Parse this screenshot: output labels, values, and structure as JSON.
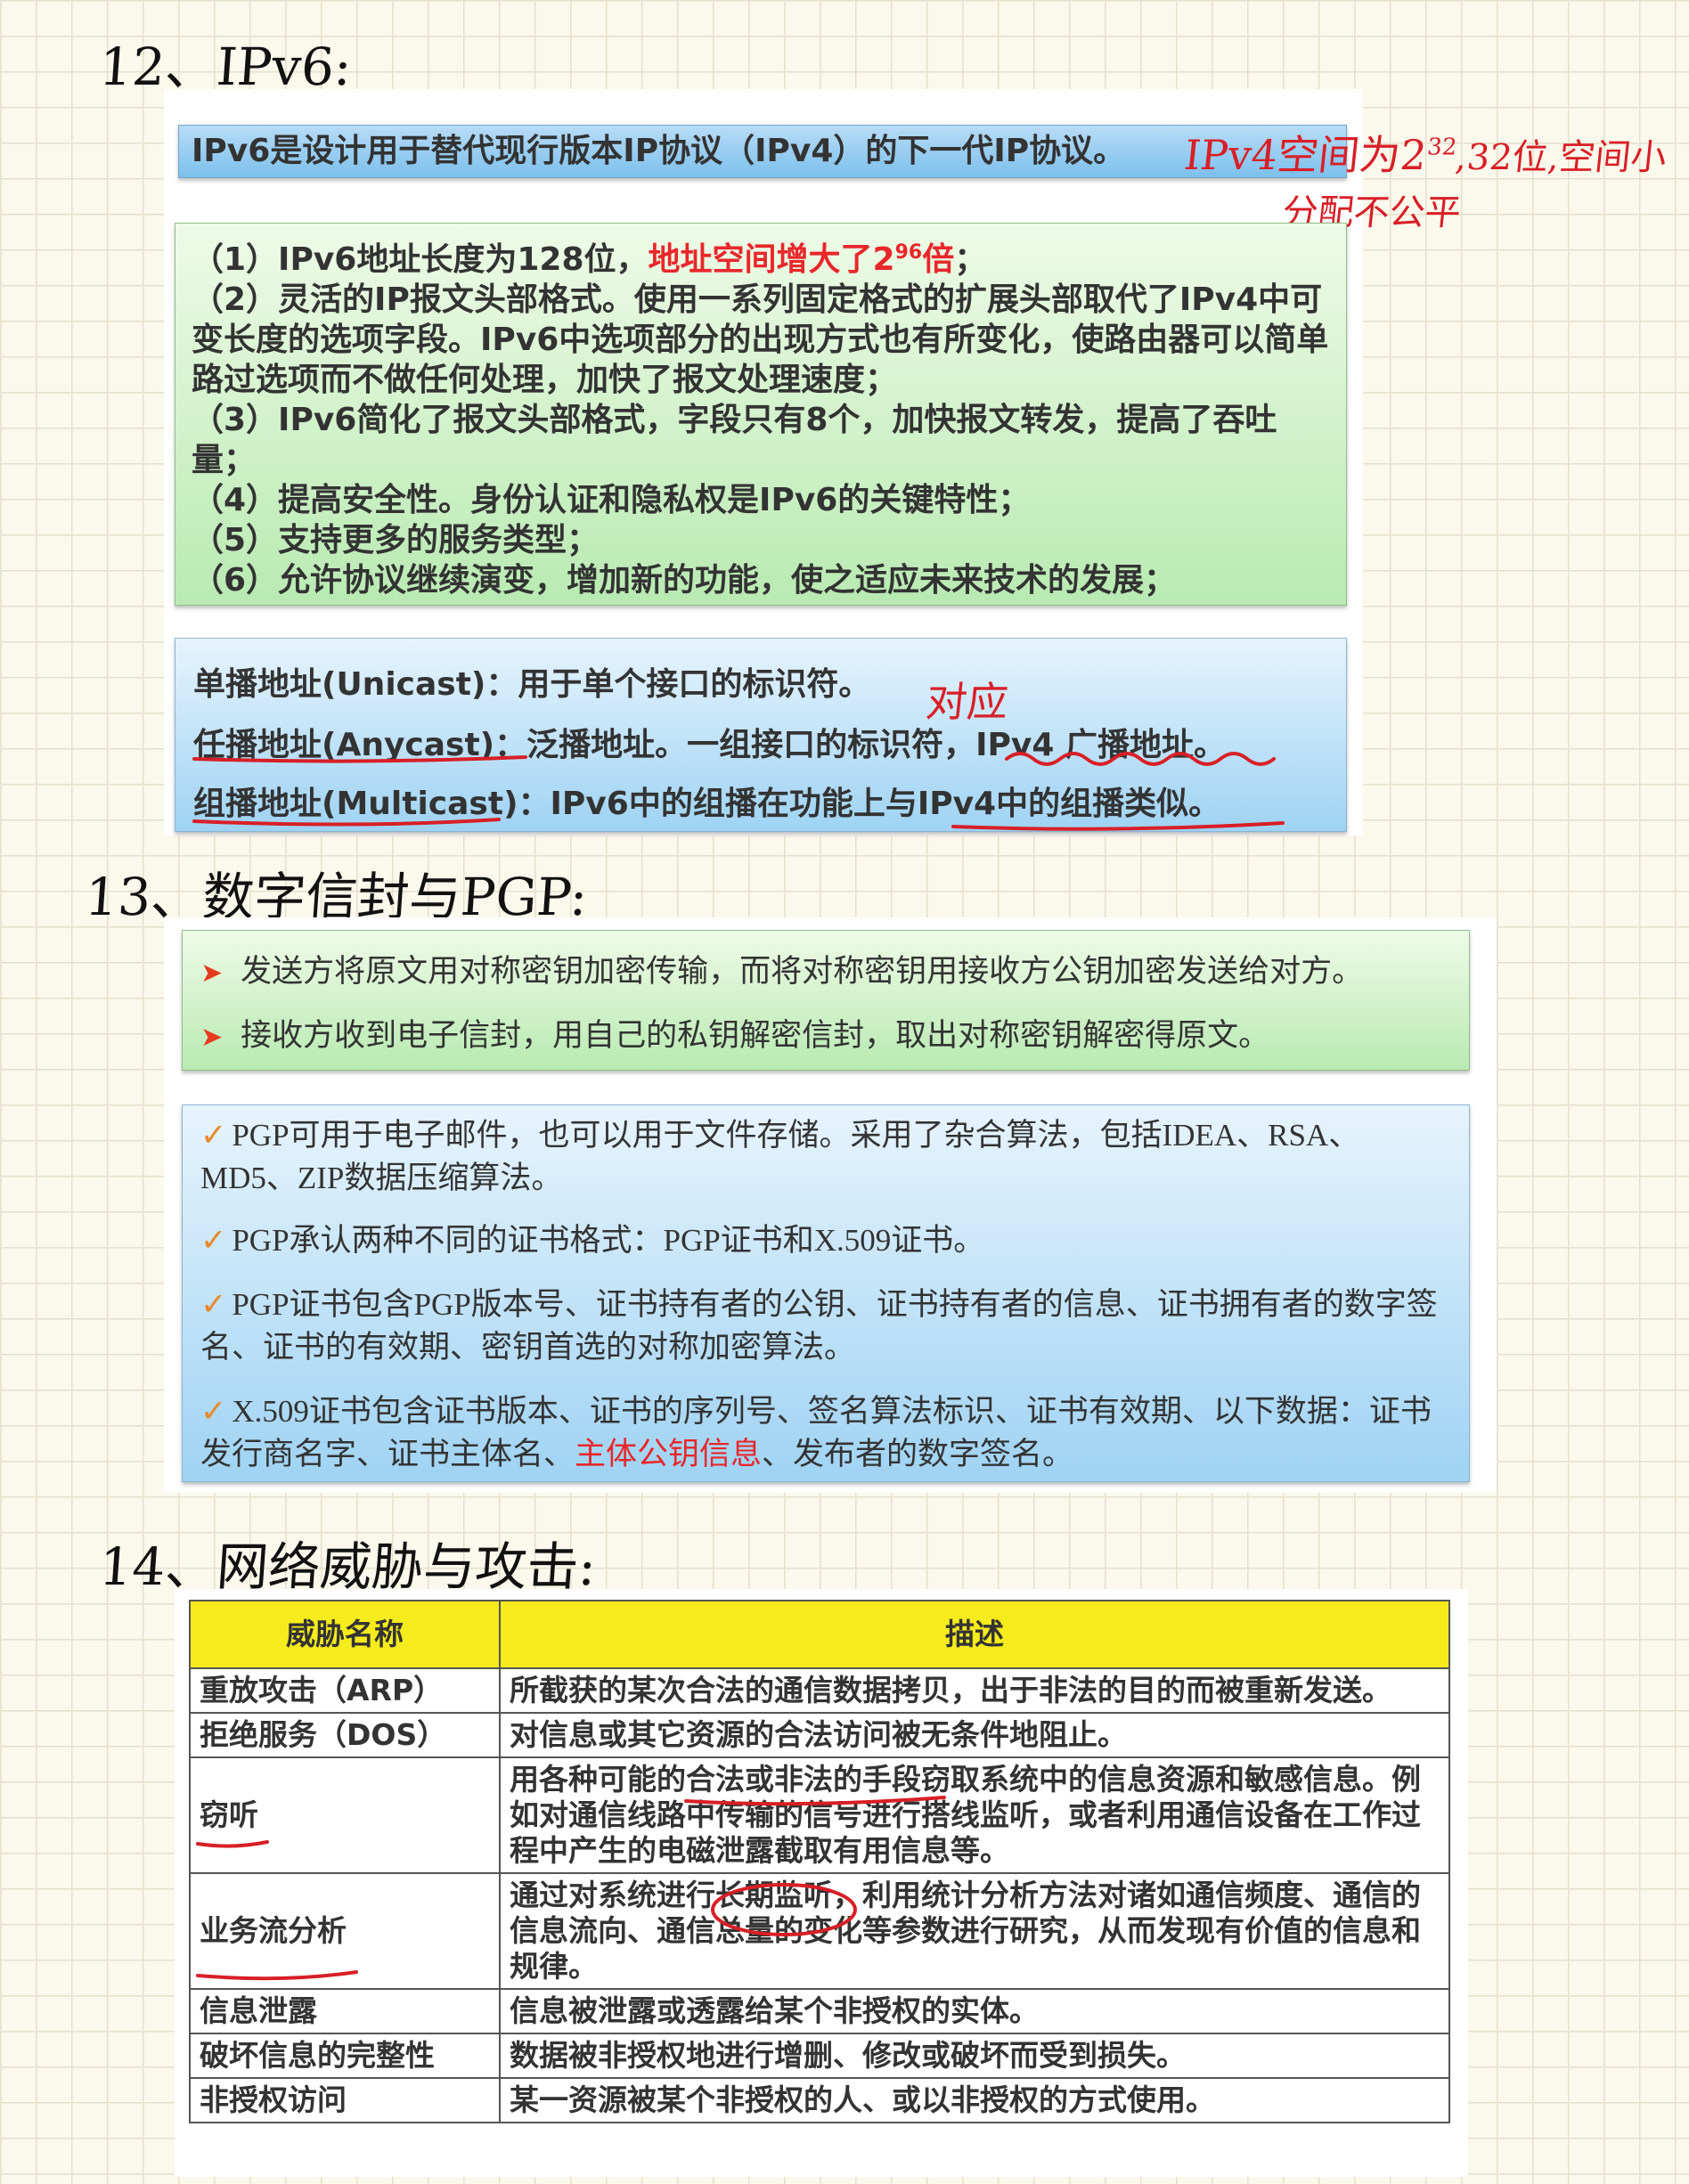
{
  "headings": {
    "h12": "12、IPv6:",
    "h13": "13、数字信封与PGP:",
    "h14": "14、网络威胁与攻击:"
  },
  "ipv6": {
    "intro": "IPv6是设计用于替代现行版本IP协议（IPv4）的下一代IP协议。",
    "note_line1": "IPv4空间为2",
    "note_sup": "32",
    "note_line1_rest": ",32位,空间小",
    "note_line2": "分配不公平",
    "features": [
      {
        "pre": "（1）IPv6地址长度为128位，",
        "red": "地址空间增大了2",
        "sup": "96",
        "red2": "倍",
        "post": "；"
      },
      {
        "text": "（2）灵活的IP报文头部格式。使用一系列固定格式的扩展头部取代了IPv4中可变长度的选项字段。IPv6中选项部分的出现方式也有所变化，使路由器可以简单路过选项而不做任何处理，加快了报文处理速度；"
      },
      {
        "text": "（3）IPv6简化了报文头部格式，字段只有8个，加快报文转发，提高了吞吐量；"
      },
      {
        "text": "（4）提高安全性。身份认证和隐私权是IPv6的关键特性；"
      },
      {
        "text": "（5）支持更多的服务类型；"
      },
      {
        "text": "（6）允许协议继续演变，增加新的功能，使之适应未来技术的发展；"
      }
    ],
    "addresses": [
      "单播地址(Unicast)：用于单个接口的标识符。",
      "任播地址(Anycast)：泛播地址。一组接口的标识符，IPv4 广播地址。",
      "组播地址(Multicast)：IPv6中的组播在功能上与IPv4中的组播类似。"
    ],
    "annotation_duiying": "对应"
  },
  "pgp": {
    "envelope": [
      "发送方将原文用对称密钥加密传输，而将对称密钥用接收方公钥加密发送给对方。",
      "接收方收到电子信封，用自己的私钥解密信封，取出对称密钥解密得原文。"
    ],
    "points": [
      {
        "text": "PGP可用于电子邮件，也可以用于文件存储。采用了杂合算法，包括IDEA、RSA、MD5、ZIP数据压缩算法。"
      },
      {
        "text": "PGP承认两种不同的证书格式：PGP证书和X.509证书。"
      },
      {
        "text": "PGP证书包含PGP版本号、证书持有者的公钥、证书持有者的信息、证书拥有者的数字签名、证书的有效期、密钥首选的对称加密算法。"
      },
      {
        "pre": "X.509证书包含证书版本、证书的序列号、签名算法标识、证书有效期、以下数据：证书发行商名字、证书主体名、",
        "red": "主体公钥信息",
        "post": "、发布者的数字签名。"
      }
    ],
    "arrow_glyph": "➤",
    "check_glyph": "✓"
  },
  "threats": {
    "headers": [
      "威胁名称",
      "描述"
    ],
    "rows": [
      {
        "name": "重放攻击（ARP）",
        "desc": "所截获的某次合法的通信数据拷贝，出于非法的目的而被重新发送。"
      },
      {
        "name": "拒绝服务（DOS）",
        "desc": "对信息或其它资源的合法访问被无条件地阻止。"
      },
      {
        "name": "窃听",
        "desc": "用各种可能的合法或非法的手段窃取系统中的信息资源和敏感信息。例如对通信线路中传输的信号进行搭线监听，或者利用通信设备在工作过程中产生的电磁泄露截取有用信息等。"
      },
      {
        "name": "业务流分析",
        "desc": "通过对系统进行长期监听，利用统计分析方法对诸如通信频度、通信的信息流向、通信总量的变化等参数进行研究，从而发现有价值的信息和规律。"
      },
      {
        "name": "信息泄露",
        "desc": "信息被泄露或透露给某个非授权的实体。"
      },
      {
        "name": "破坏信息的完整性",
        "desc": "数据被非授权地进行增删、修改或破坏而受到损失。"
      },
      {
        "name": "非授权访问",
        "desc": "某一资源被某个非授权的人、或以非授权的方式使用。"
      }
    ]
  }
}
